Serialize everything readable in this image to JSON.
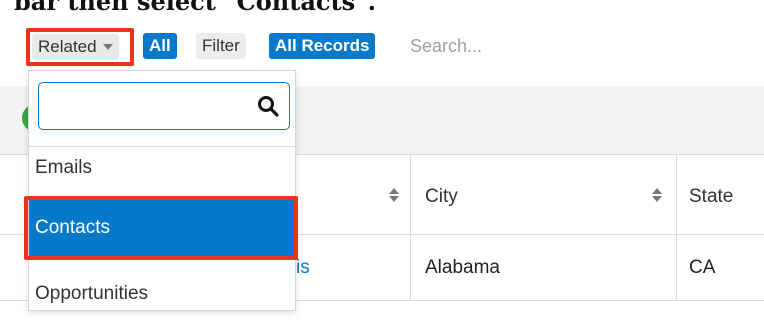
{
  "instruction_text": "bar then select \"Contacts\".",
  "toolbar": {
    "related_label": "Related",
    "all_label": "All",
    "filter_label": "Filter",
    "all_records_label": "All Records",
    "search_placeholder": "Search..."
  },
  "dropdown": {
    "search_value": "",
    "items": [
      {
        "label": "Emails",
        "selected": false
      },
      {
        "label": "Contacts",
        "selected": true
      },
      {
        "label": "Opportunities",
        "selected": false
      }
    ]
  },
  "table": {
    "columns": [
      "City",
      "State"
    ],
    "rows": [
      {
        "name_fragment": "is",
        "city": "Alabama",
        "state": "CA"
      }
    ]
  },
  "colors": {
    "accent": "#0679c8",
    "highlight": "#e8331f",
    "status_green": "#37a640"
  }
}
